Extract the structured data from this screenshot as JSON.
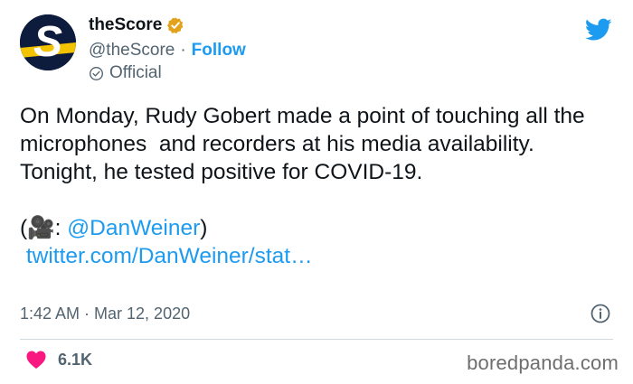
{
  "account": {
    "name": "theScore",
    "handle": "@theScore",
    "separator": "·",
    "follow_label": "Follow",
    "official_label": "Official"
  },
  "tweet": {
    "text": "On Monday, Rudy Gobert made a point of touching all the microphones  and recorders at his media availability. Tonight, he tested positive for COVID-19.",
    "credit_open": "(🎥: ",
    "credit_handle": "@DanWeiner",
    "credit_close": ")",
    "link": "twitter.com/DanWeiner/stat…",
    "timestamp": "1:42 AM · Mar 12, 2020"
  },
  "engagement": {
    "likes": "6.1K"
  },
  "watermark": "boredpanda.com",
  "colors": {
    "link": "#1d9bf0",
    "verified": "#e2a21b",
    "heart": "#f91880",
    "avatar_bg": "#0d1b3d"
  },
  "icons": [
    "thescore-logo",
    "verified-badge-icon",
    "official-check-icon",
    "twitter-bird-icon",
    "info-icon",
    "heart-icon"
  ]
}
